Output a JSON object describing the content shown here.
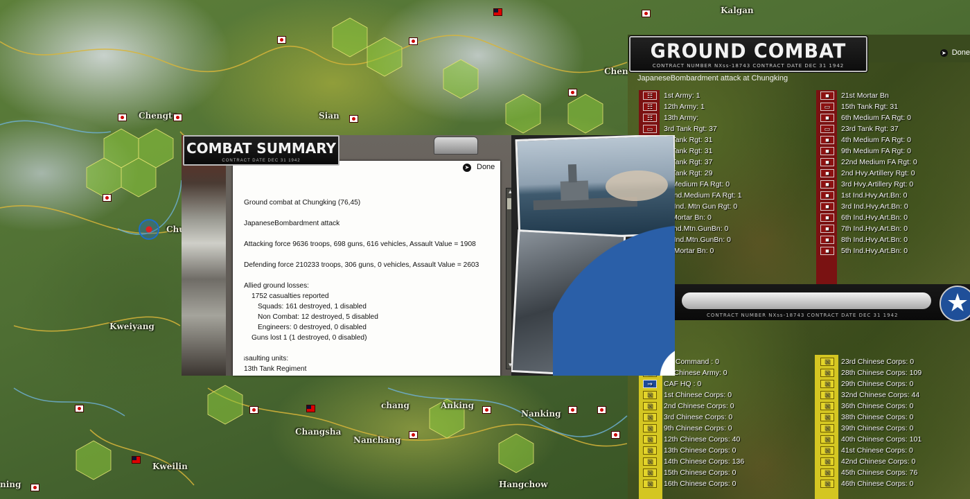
{
  "map": {
    "cities": [
      "Kalgan",
      "Chengtu",
      "Sian",
      "Chen",
      "Chu",
      "Kweiyang",
      "Anking",
      "Nanking",
      "Changsha",
      "chang",
      "Nanchang",
      "Kweilin",
      "Hangchow",
      "ning"
    ]
  },
  "ground_combat": {
    "title": "GROUND COMBAT",
    "banner_sub": "CONTRACT NUMBER  NXss-18743      CONTRACT DATE  DEC 31 1942",
    "done_label": "Done",
    "headline": "JapaneseBombardment attack at Chungking",
    "attackers_left": [
      "1st Army: 1",
      "12th Army: 1",
      "13th Army:",
      "3rd Tank Rgt: 37",
      "th Tank Rgt: 31",
      "th Tank Rgt: 31",
      "th Tank Rgt: 37",
      "th Tank Rgt: 29",
      "th Medium FA Rgt: 0",
      "th Ind.Medium FA Rgt: 1",
      "nd Ind. Mtn Gun Rgt: 0",
      "st Mortar Bn: 0",
      "st Ind.Mtn.GunBn: 0",
      "nd Ind.Mtn.GunBn: 0",
      "nd Mortar Bn: 0"
    ],
    "attackers_right": [
      "21st Mortar Bn",
      "15th Tank Rgt: 31",
      "6th Medium FA Rgt: 0",
      "23rd Tank Rgt: 37",
      "4th Medium FA Rgt: 0",
      "9th Medium FA Rgt: 0",
      "22nd Medium FA Rgt: 0",
      "2nd Hvy.Artillery Rgt: 0",
      "3rd Hvy.Artillery Rgt: 0",
      "1st Ind.Hvy.Art.Bn: 0",
      "3rd Ind.Hvy.Art.Bn: 0",
      "6th Ind.Hvy.Art.Bn: 0",
      "7th Ind.Hvy.Art.Bn: 0",
      "8th Ind.Hvy.Art.Bn: 0",
      "5th Ind.Hvy.Art.Bn: 0"
    ],
    "defenders_left": [
      "ina Command : 0",
      "nd Chinese Army: 0",
      "CAF HQ : 0",
      "1st Chinese Corps: 0",
      "2nd Chinese Corps: 0",
      "3rd Chinese Corps: 0",
      "9th Chinese Corps: 0",
      "12th Chinese Corps: 40",
      "13th Chinese Corps: 0",
      "14th Chinese Corps: 136",
      "15th Chinese Corps: 0",
      "16th Chinese Corps: 0"
    ],
    "defenders_right": [
      "23rd Chinese Corps: 0",
      "28th Chinese Corps: 109",
      "29th Chinese Corps: 0",
      "32nd Chinese Corps: 44",
      "36th Chinese Corps: 0",
      "38th Chinese Corps: 0",
      "39th Chinese Corps: 0",
      "40th Chinese Corps: 101",
      "41st Chinese Corps: 0",
      "42nd Chinese Corps: 0",
      "45th Chinese Corps: 76",
      "46th Chinese Corps: 0"
    ],
    "mid_bar_sub": "CONTRACT NUMBER  NXss-18743      CONTRACT DATE  DEC 31 1942"
  },
  "combat_summary": {
    "title": "COMBAT SUMMARY",
    "banner_sub": "CONTRACT DATE  DEC 31 1942",
    "done_label": "Done",
    "lines": [
      "Ground combat at Chungking (76,45)",
      "JapaneseBombardment attack",
      "Attacking force 9636 troops, 698 guns, 616 vehicles, Assault Value = 1908",
      "Defending force 210233 troops, 306 guns, 0 vehicles, Assault Value = 2603",
      "Allied ground losses:",
      "1752 casualties reported",
      "Squads: 161 destroyed, 1 disabled",
      "Non Combat: 12 destroyed, 5 disabled",
      "Engineers: 0 destroyed, 0 disabled",
      "Guns lost 1 (1 destroyed, 0 disabled)",
      "Assaulting units:",
      "13th Tank Regiment"
    ]
  },
  "colors": {
    "japan_red": "#8c1111",
    "china_yellow": "#e4d52a",
    "panel_black": "#0d0d0d"
  }
}
